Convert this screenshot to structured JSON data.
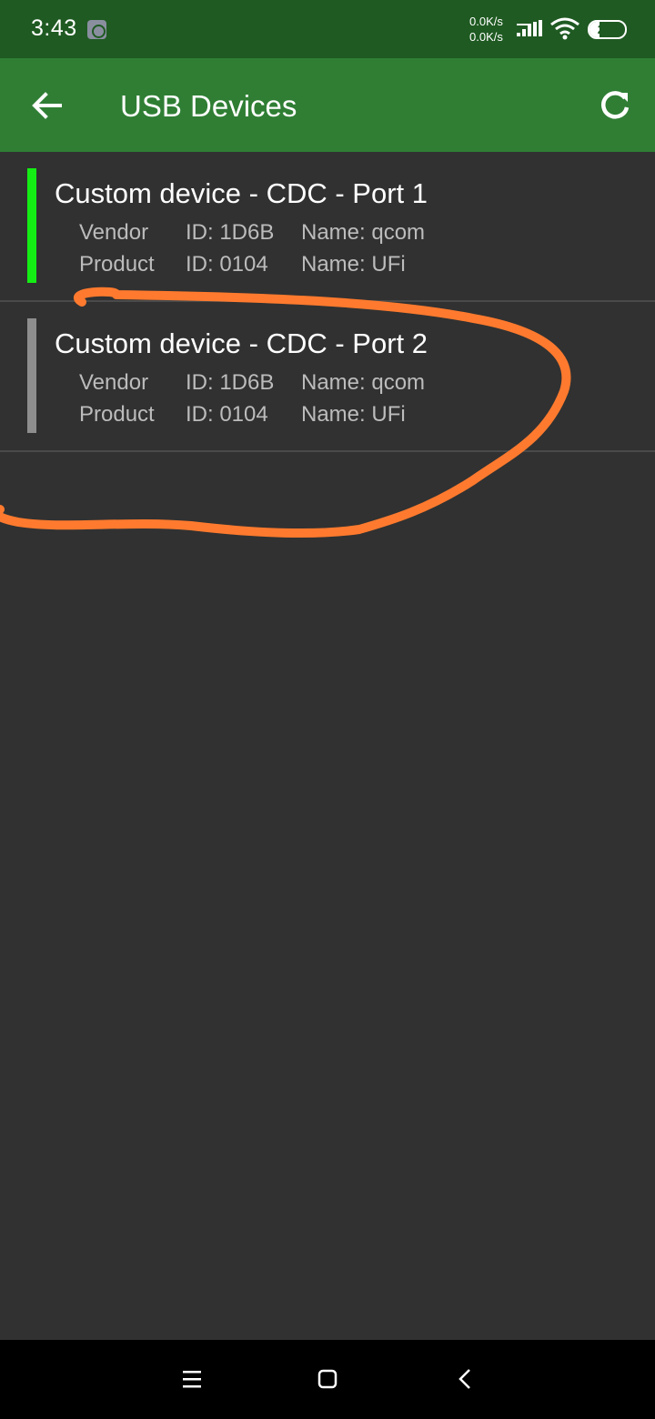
{
  "status_bar": {
    "time": "3:43",
    "net_up": "0.0K/s",
    "net_down": "0.0K/s",
    "battery_level": "27",
    "battery_fraction": 0.27,
    "icons": [
      "notification-icon",
      "signal-icon",
      "wifi-icon",
      "battery-icon"
    ]
  },
  "app_bar": {
    "title": "USB Devices",
    "back_icon": "arrow-left-icon",
    "refresh_icon": "refresh-icon"
  },
  "devices": [
    {
      "title": "Custom device - CDC - Port 1",
      "status_color": "#14ee14",
      "vendor": {
        "label": "Vendor",
        "id": "ID: 1D6B",
        "name": "Name: qcom"
      },
      "product": {
        "label": "Product",
        "id": "ID: 0104",
        "name": "Name: UFi"
      }
    },
    {
      "title": "Custom device - CDC - Port 2",
      "status_color": "#8e8e8e",
      "vendor": {
        "label": "Vendor",
        "id": "ID: 1D6B",
        "name": "Name: qcom"
      },
      "product": {
        "label": "Product",
        "id": "ID: 0104",
        "name": "Name: UFi"
      }
    }
  ],
  "colors": {
    "status_bar": "#1f5a22",
    "app_bar": "#2f7e34",
    "background": "#313131",
    "annotation": "#ff7a2e"
  },
  "nav_bar": {
    "icons": [
      "menu-icon",
      "home-square-icon",
      "back-chevron-icon"
    ]
  }
}
